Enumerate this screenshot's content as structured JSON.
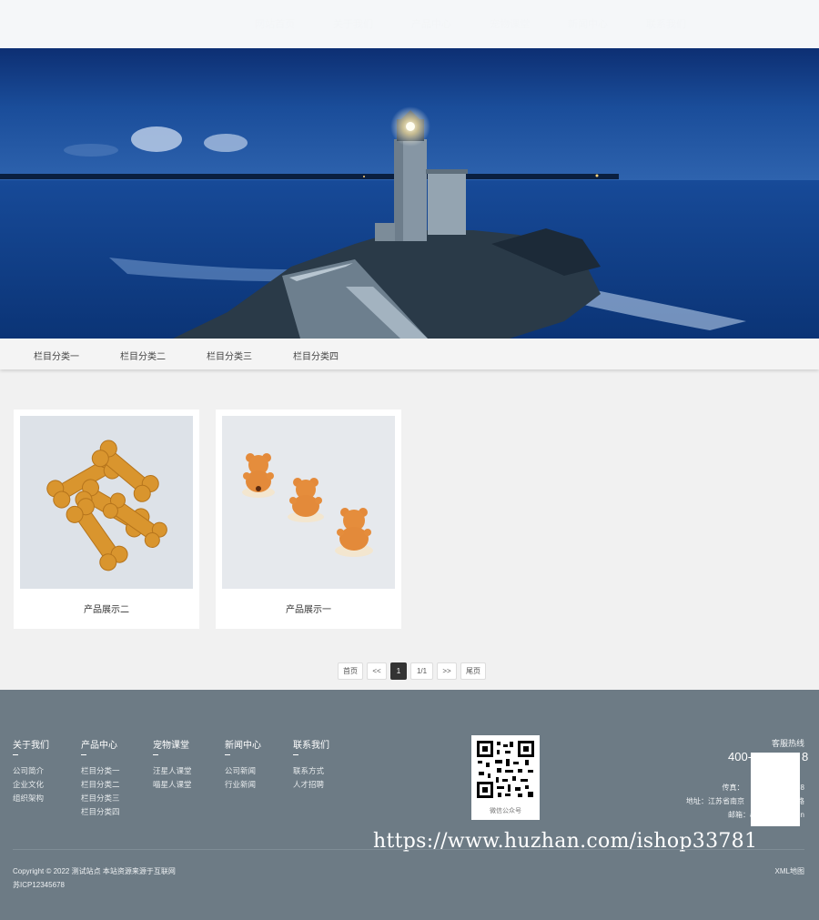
{
  "header": {
    "nav": [
      "网站首页",
      "关于我们",
      "产品中心",
      "宠物课堂",
      "新闻中心",
      "联系我们"
    ]
  },
  "subnav": {
    "items": [
      "栏目分类一",
      "栏目分类二",
      "栏目分类三",
      "栏目分类四"
    ]
  },
  "products": [
    {
      "caption": "产品展示二"
    },
    {
      "caption": "产品展示一"
    }
  ],
  "pagination": {
    "first": "首页",
    "prev": "<<",
    "current": "1",
    "total": "1/1",
    "next": ">>",
    "last": "尾页"
  },
  "footer": {
    "columns": [
      {
        "title": "关于我们",
        "links": [
          "公司简介",
          "企业文化",
          "组织架构"
        ]
      },
      {
        "title": "产品中心",
        "links": [
          "栏目分类一",
          "栏目分类二",
          "栏目分类三",
          "栏目分类四"
        ]
      },
      {
        "title": "宠物课堂",
        "links": [
          "汪星人课堂",
          "喵星人课堂"
        ]
      },
      {
        "title": "新闻中心",
        "links": [
          "公司新闻",
          "行业新闻"
        ]
      },
      {
        "title": "联系我们",
        "links": [
          "联系方式",
          "人才招聘"
        ]
      }
    ],
    "qr_label": "微信公众号",
    "hotline_label": "客服热线",
    "hotline_number": "400-",
    "hotline_tail": "8",
    "fax": "传真：",
    "fax_tail": "8",
    "address": "地址：江苏省南京",
    "address_tail": "路",
    "email": "邮箱：adm",
    "email_tail": "n",
    "watermark": "https://www.huzhan.com/ishop33781",
    "copyright": "Copyright © 2022 测试站点 本站资源来源于互联网",
    "icp": "苏ICP12345678",
    "xml_map": "XML地图"
  },
  "colors": {
    "footer_bg": "#6d7b85",
    "page_bg": "#f1f1f1",
    "active_page": "#333333"
  }
}
